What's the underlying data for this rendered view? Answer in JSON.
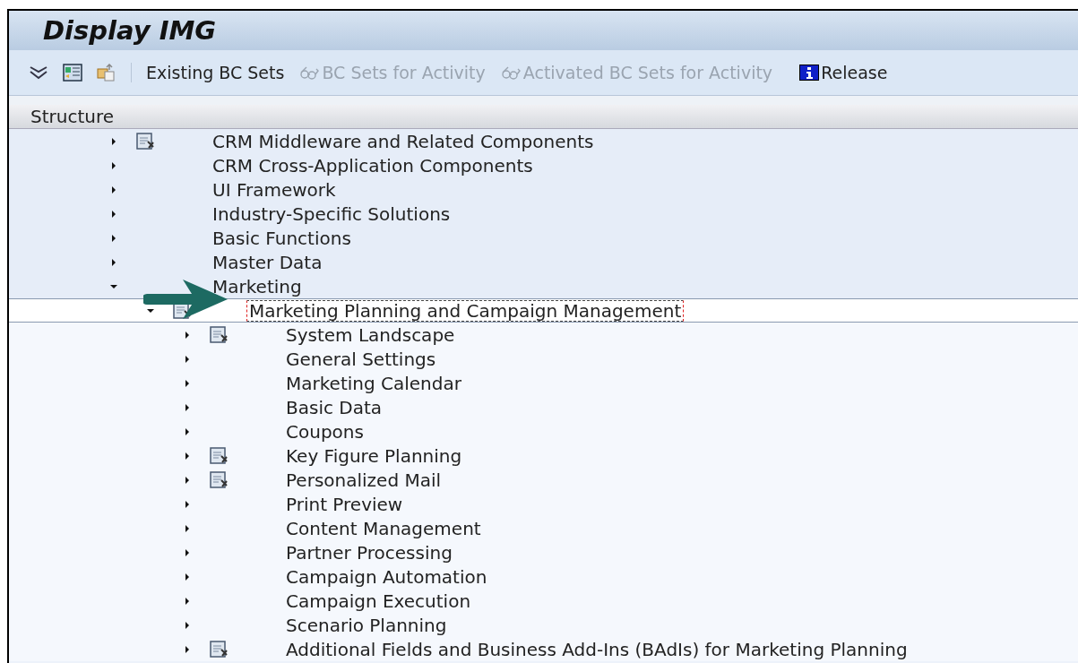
{
  "window": {
    "title": "Display IMG"
  },
  "toolbar": {
    "buttons": [
      {
        "label": "Existing BC Sets",
        "kind": "text",
        "disabled": false
      },
      {
        "label": "BC Sets for Activity",
        "kind": "glasses",
        "disabled": true
      },
      {
        "label": "Activated BC Sets for Activity",
        "kind": "glasses",
        "disabled": true
      },
      {
        "label": "Release",
        "kind": "info",
        "disabled": false
      }
    ]
  },
  "tree": {
    "header": "Structure",
    "items": [
      {
        "label": "CRM Middleware and Related Components",
        "kind": "activity",
        "expanded": false,
        "selected": false
      },
      {
        "label": "CRM Cross-Application Components",
        "kind": "node",
        "expanded": false,
        "selected": false
      },
      {
        "label": "UI Framework",
        "kind": "node",
        "expanded": false,
        "selected": false
      },
      {
        "label": "Industry-Specific Solutions",
        "kind": "node",
        "expanded": false,
        "selected": false
      },
      {
        "label": "Basic Functions",
        "kind": "node",
        "expanded": false,
        "selected": false
      },
      {
        "label": "Master Data",
        "kind": "node",
        "expanded": false,
        "selected": false
      },
      {
        "label": "Marketing",
        "kind": "node",
        "expanded": true,
        "selected": false,
        "children": [
          {
            "label": "Marketing Planning and Campaign Management",
            "kind": "activity",
            "expanded": true,
            "selected": true,
            "children": [
              {
                "label": "System Landscape",
                "kind": "activity",
                "expanded": false,
                "selected": false
              },
              {
                "label": "General Settings",
                "kind": "node",
                "expanded": false,
                "selected": false
              },
              {
                "label": "Marketing Calendar",
                "kind": "node",
                "expanded": false,
                "selected": false
              },
              {
                "label": "Basic Data",
                "kind": "node",
                "expanded": false,
                "selected": false
              },
              {
                "label": "Coupons",
                "kind": "node",
                "expanded": false,
                "selected": false
              },
              {
                "label": "Key Figure Planning",
                "kind": "activity",
                "expanded": false,
                "selected": false
              },
              {
                "label": "Personalized Mail",
                "kind": "activity",
                "expanded": false,
                "selected": false
              },
              {
                "label": "Print Preview",
                "kind": "node",
                "expanded": false,
                "selected": false
              },
              {
                "label": "Content Management",
                "kind": "node",
                "expanded": false,
                "selected": false
              },
              {
                "label": "Partner Processing",
                "kind": "node",
                "expanded": false,
                "selected": false
              },
              {
                "label": "Campaign Automation",
                "kind": "node",
                "expanded": false,
                "selected": false
              },
              {
                "label": "Campaign Execution",
                "kind": "node",
                "expanded": false,
                "selected": false
              },
              {
                "label": "Scenario Planning",
                "kind": "node",
                "expanded": false,
                "selected": false
              },
              {
                "label": "Additional Fields and Business Add-Ins (BAdIs) for Marketing Planning",
                "kind": "activity",
                "expanded": false,
                "selected": false
              }
            ]
          }
        ]
      }
    ]
  }
}
